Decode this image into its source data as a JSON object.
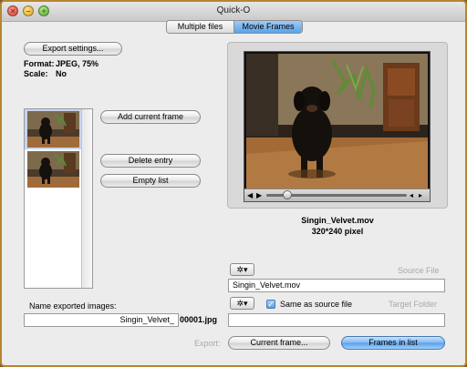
{
  "window": {
    "title": "Quick-O"
  },
  "tabs": [
    {
      "label": "Multiple files",
      "selected": false
    },
    {
      "label": "Movie Frames",
      "selected": true
    }
  ],
  "export_settings": {
    "button_label": "Export settings...",
    "format_label": "Format:",
    "format_value": "JPEG, 75%",
    "scale_label": "Scale:",
    "scale_value": "No"
  },
  "frame_actions": {
    "add_label": "Add current frame",
    "delete_label": "Delete entry",
    "empty_label": "Empty list"
  },
  "movie": {
    "name": "Singin_Velvet.mov",
    "dimensions": "320*240 pixel"
  },
  "source": {
    "label": "Source File",
    "value": "Singin_Velvet.mov"
  },
  "target": {
    "label": "Target Folder",
    "same_as_source_label": "Same as source file",
    "same_as_source_checked": true,
    "value": ""
  },
  "naming": {
    "label": "Name exported images:",
    "prefix": "Singin_Velvet_",
    "suffix": "00001.jpg"
  },
  "export": {
    "label": "Export:",
    "current_frame_label": "Current frame...",
    "frames_in_list_label": "Frames in list"
  },
  "icons": {
    "close": "close-icon",
    "minimize": "minimize-icon",
    "zoom": "zoom-icon",
    "gear": "gear-icon",
    "play": "play-icon",
    "volume": "volume-icon"
  },
  "colors": {
    "accent": "#5aa2e8",
    "window_border": "#b8862e"
  }
}
